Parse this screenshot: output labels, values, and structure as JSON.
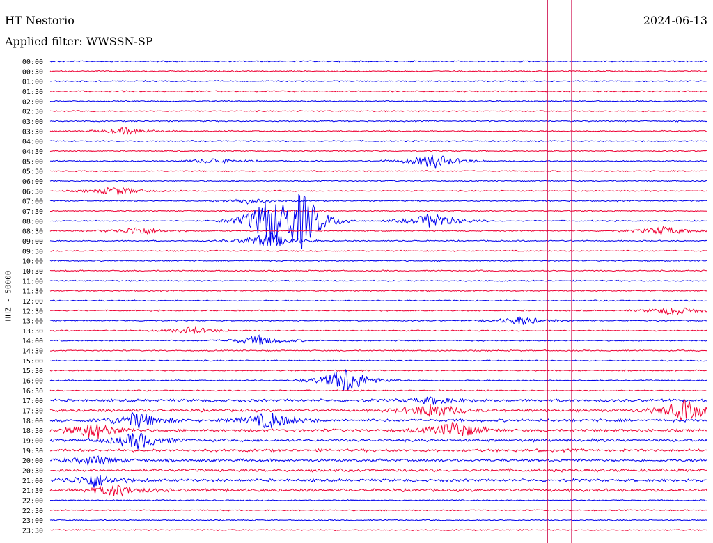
{
  "header": {
    "station": "HT Nestorio",
    "date": "2024-06-13",
    "filter": "Applied filter: WWSSN-SP"
  },
  "colors": {
    "blue": "#0000ee",
    "red": "#ee0033",
    "marker": "#cc0044"
  },
  "chart_data": {
    "type": "line",
    "ylabel": "HHZ - 50000",
    "row_labels": [
      "00:00",
      "00:30",
      "01:00",
      "01:30",
      "02:00",
      "02:30",
      "03:00",
      "03:30",
      "04:00",
      "04:30",
      "05:00",
      "05:30",
      "06:00",
      "06:30",
      "07:00",
      "07:30",
      "08:00",
      "08:30",
      "09:00",
      "09:30",
      "10:00",
      "10:30",
      "11:00",
      "11:30",
      "12:00",
      "12:30",
      "13:00",
      "13:30",
      "14:00",
      "14:30",
      "15:00",
      "15:30",
      "16:00",
      "16:30",
      "17:00",
      "17:30",
      "18:00",
      "18:30",
      "19:00",
      "19:30",
      "20:00",
      "20:30",
      "21:00",
      "21:30",
      "22:00",
      "22:30",
      "23:00",
      "23:30"
    ],
    "trace_colors_alternate": [
      "blue",
      "red"
    ],
    "trace_duration_minutes": 30,
    "events": [
      {
        "row": "03:30",
        "minute": 3.5,
        "amp": 0.4
      },
      {
        "row": "05:00",
        "minute": 7.5,
        "amp": 0.3
      },
      {
        "row": "05:00",
        "minute": 17.5,
        "amp": 0.9
      },
      {
        "row": "06:30",
        "minute": 3,
        "amp": 0.5
      },
      {
        "row": "07:00",
        "minute": 9,
        "amp": 0.3
      },
      {
        "row": "08:00",
        "minute": 10,
        "amp": 2.6
      },
      {
        "row": "08:00",
        "minute": 11.5,
        "amp": 3.0
      },
      {
        "row": "08:00",
        "minute": 17.5,
        "amp": 1.0
      },
      {
        "row": "08:30",
        "minute": 4,
        "amp": 0.5
      },
      {
        "row": "08:30",
        "minute": 28,
        "amp": 0.5
      },
      {
        "row": "09:00",
        "minute": 10,
        "amp": 1.0
      },
      {
        "row": "12:30",
        "minute": 28.5,
        "amp": 0.5
      },
      {
        "row": "13:00",
        "minute": 21.5,
        "amp": 0.5
      },
      {
        "row": "13:30",
        "minute": 6.5,
        "amp": 0.4
      },
      {
        "row": "14:00",
        "minute": 9.5,
        "amp": 0.6
      },
      {
        "row": "16:00",
        "minute": 13.5,
        "amp": 1.6
      },
      {
        "row": "17:00",
        "minute": 17.5,
        "amp": 0.4
      },
      {
        "row": "17:30",
        "minute": 17.5,
        "amp": 0.9
      },
      {
        "row": "17:30",
        "minute": 29,
        "amp": 1.2
      },
      {
        "row": "18:00",
        "minute": 4,
        "amp": 1.0
      },
      {
        "row": "18:00",
        "minute": 10,
        "amp": 1.0
      },
      {
        "row": "18:30",
        "minute": 2,
        "amp": 1.0
      },
      {
        "row": "18:30",
        "minute": 18.5,
        "amp": 1.0
      },
      {
        "row": "19:00",
        "minute": 4,
        "amp": 1.0
      },
      {
        "row": "20:00",
        "minute": 2,
        "amp": 0.5
      },
      {
        "row": "21:00",
        "minute": 2,
        "amp": 0.8
      },
      {
        "row": "21:30",
        "minute": 3,
        "amp": 0.7
      }
    ],
    "vertical_markers_minutes": [
      22.7,
      23.8
    ]
  }
}
